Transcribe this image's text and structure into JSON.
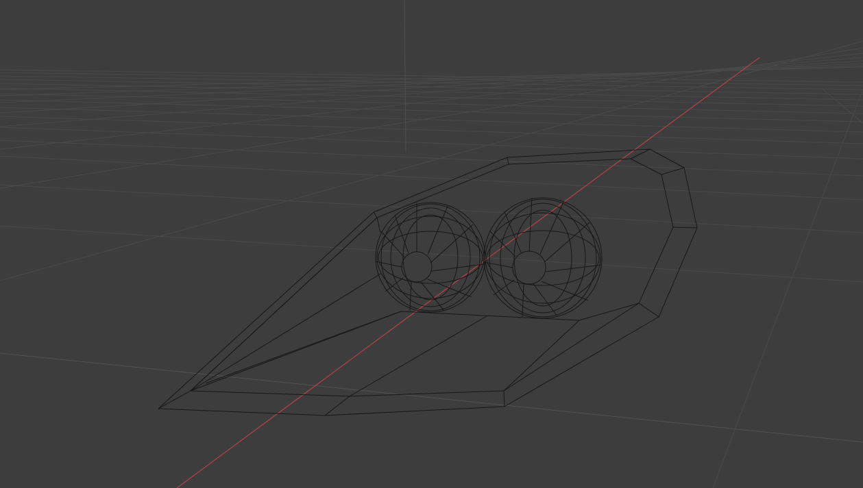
{
  "viewport": {
    "background_color": "#3d3d3d",
    "grid_color": "#4a4a4a",
    "x_axis_color": "#b0414c",
    "z_axis_color": "#4f4f4f",
    "wireframe_color": "#171717",
    "shading_mode": "wireframe",
    "objects": [
      {
        "name": "pod-body",
        "type": "mesh"
      },
      {
        "name": "left-sphere",
        "type": "uv-sphere"
      },
      {
        "name": "right-sphere",
        "type": "uv-sphere"
      }
    ]
  }
}
